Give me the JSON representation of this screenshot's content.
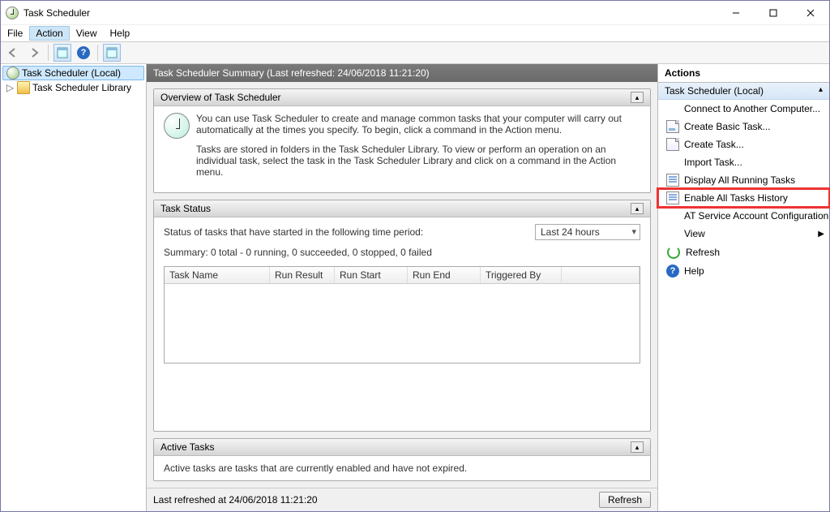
{
  "window": {
    "title": "Task Scheduler"
  },
  "menubar": {
    "file": "File",
    "action": "Action",
    "view": "View",
    "help": "Help"
  },
  "tree": {
    "root": "Task Scheduler (Local)",
    "library": "Task Scheduler Library"
  },
  "summary": {
    "header": "Task Scheduler Summary (Last refreshed: 24/06/2018 11:21:20)"
  },
  "overview": {
    "title": "Overview of Task Scheduler",
    "p1": "You can use Task Scheduler to create and manage common tasks that your computer will carry out automatically at the times you specify. To begin, click a command in the Action menu.",
    "p2": "Tasks are stored in folders in the Task Scheduler Library. To view or perform an operation on an individual task, select the task in the Task Scheduler Library and click on a command in the Action menu."
  },
  "status": {
    "title": "Task Status",
    "period_label": "Status of tasks that have started in the following time period:",
    "period_value": "Last 24 hours",
    "summary_line": "Summary: 0 total - 0 running, 0 succeeded, 0 stopped, 0 failed",
    "columns": {
      "name": "Task Name",
      "result": "Run Result",
      "start": "Run Start",
      "end": "Run End",
      "trigger": "Triggered By"
    }
  },
  "active": {
    "title": "Active Tasks",
    "desc": "Active tasks are tasks that are currently enabled and have not expired."
  },
  "footer": {
    "refreshed": "Last refreshed at 24/06/2018 11:21:20",
    "refresh_btn": "Refresh"
  },
  "actions": {
    "header": "Actions",
    "group": "Task Scheduler (Local)",
    "items": {
      "connect": "Connect to Another Computer...",
      "create_basic": "Create Basic Task...",
      "create_task": "Create Task...",
      "import": "Import Task...",
      "display_running": "Display All Running Tasks",
      "enable_history": "Enable All Tasks History",
      "at_service": "AT Service Account Configuration",
      "view": "View",
      "refresh": "Refresh",
      "help": "Help"
    }
  }
}
